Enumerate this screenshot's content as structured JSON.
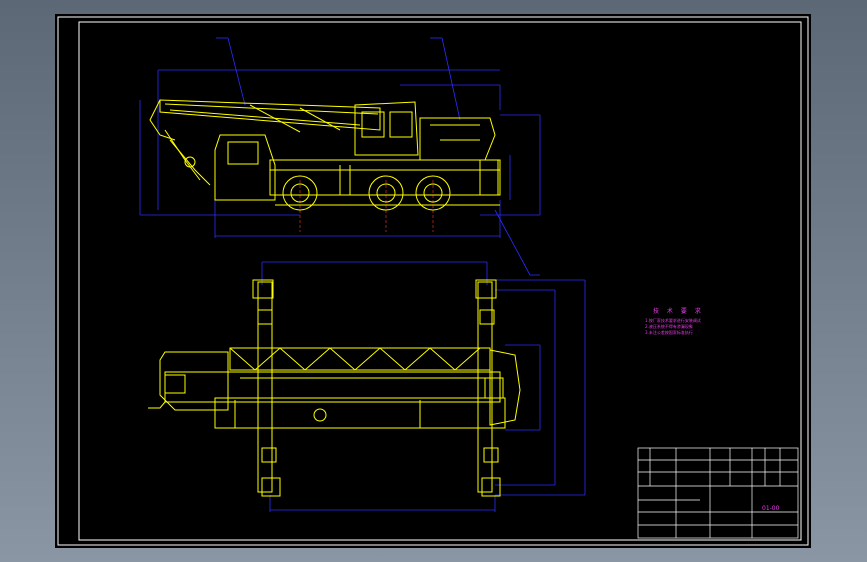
{
  "window": {
    "background": "#000000"
  },
  "colors": {
    "frame": "#ffffff",
    "part": "#ffff00",
    "dimension": "#2b2bff",
    "text": "#e83ee8",
    "centerline": "#ff3030"
  },
  "technical_requirements": {
    "title": "技 术 要 求",
    "items": [
      "1.按厂家技术要求进行安装调试",
      "2.液压系统不得有渗漏现象",
      "3.未注公差按国家标准执行"
    ]
  },
  "title_block": {
    "drawing_number": "01-00"
  }
}
